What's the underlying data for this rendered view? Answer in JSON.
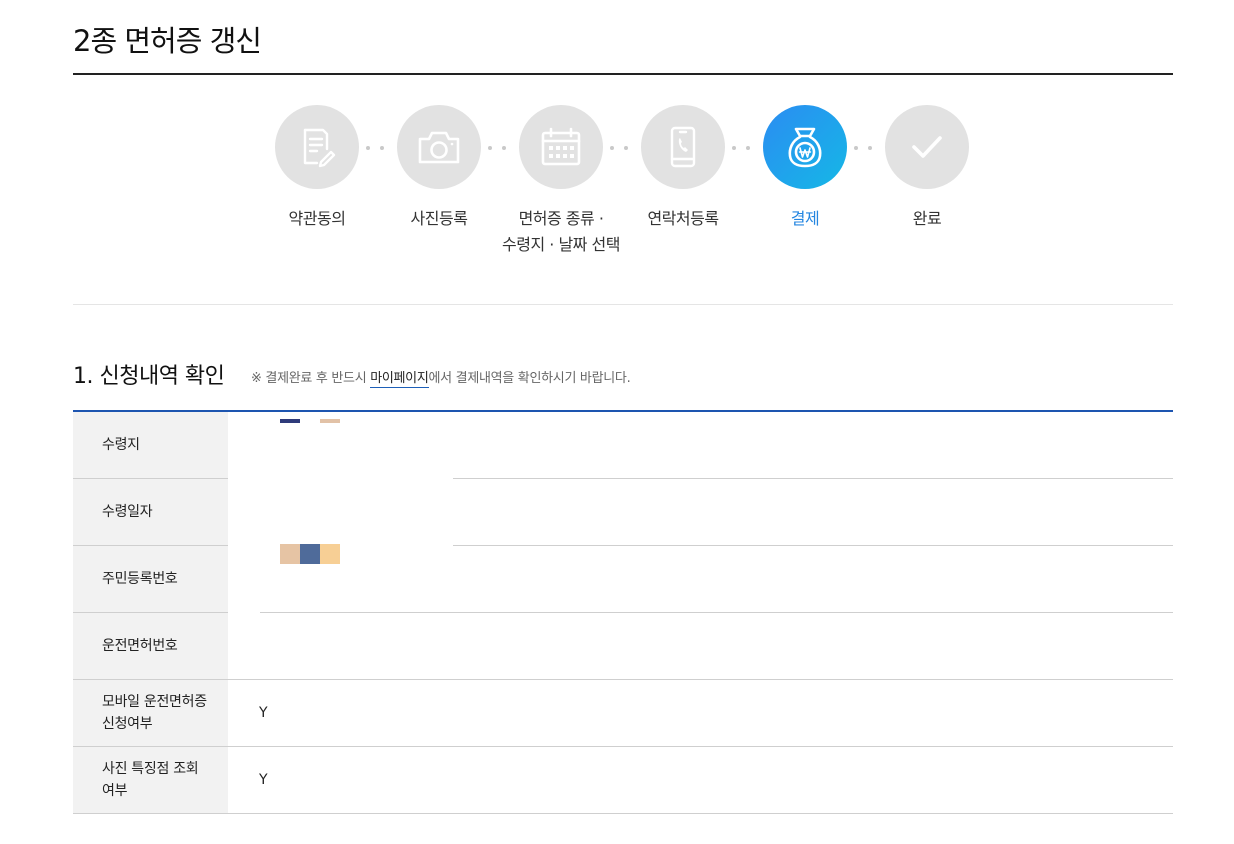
{
  "page": {
    "title": "2종 면허증 갱신"
  },
  "steps": [
    {
      "label": "약관동의",
      "icon": "document-pen-icon",
      "active": false
    },
    {
      "label": "사진등록",
      "icon": "camera-icon",
      "active": false
    },
    {
      "label": "면허증 종류 · 수령지 · 날짜 선택",
      "label_line1": "면허증 종류 ·",
      "label_line2": "수령지 · 날짜 선택",
      "icon": "calendar-icon",
      "active": false
    },
    {
      "label": "연락처등록",
      "icon": "phone-icon",
      "active": false
    },
    {
      "label": "결제",
      "icon": "money-bag-won-icon",
      "active": true
    },
    {
      "label": "완료",
      "icon": "check-icon",
      "active": false
    }
  ],
  "colors": {
    "active_step": "#1f9bec",
    "active_label": "#2486e0",
    "inactive_step": "#e2e2e2",
    "table_top_border": "#1d55b0"
  },
  "section": {
    "title": "1. 신청내역 확인",
    "note_prefix": "※ 결제완료 후 반드시 ",
    "note_link": "마이페이지",
    "note_suffix": "에서 결제내역을 확인하시기 바랍니다."
  },
  "rows": [
    {
      "label": "수령지",
      "value": ""
    },
    {
      "label": "수령일자",
      "value": ""
    },
    {
      "label": "주민등록번호",
      "value": ""
    },
    {
      "label": "운전면허번호",
      "value": ""
    },
    {
      "label": "모바일 운전면허증 신청여부",
      "label_line1": "모바일 운전면허증",
      "label_line2": "신청여부",
      "value": "Y"
    },
    {
      "label": "사진 특징점 조회 여부",
      "label_line1": "사진 특징점 조회",
      "label_line2": "여부",
      "value": "Y"
    }
  ]
}
